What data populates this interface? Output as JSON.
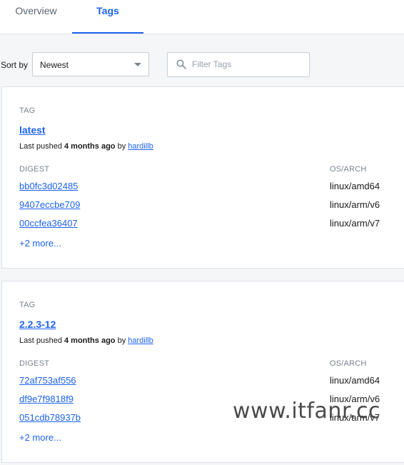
{
  "tabs": [
    {
      "label": "Overview"
    },
    {
      "label": "Tags"
    }
  ],
  "sort": {
    "label": "Sort by",
    "value": "Newest"
  },
  "filter": {
    "placeholder": "Filter Tags"
  },
  "tag_cards": [
    {
      "tag_label": "TAG",
      "tag_name": "latest",
      "pushed_prefix": "Last pushed",
      "pushed_when": "4 months ago",
      "pushed_by": "by",
      "user": "hardillb",
      "digest_header": "DIGEST",
      "os_header": "OS/ARCH",
      "rows": [
        {
          "digest": "bb0fc3d02485",
          "os": "linux/amd64"
        },
        {
          "digest": "9407eccbe709",
          "os": "linux/arm/v6"
        },
        {
          "digest": "00ccfea36407",
          "os": "linux/arm/v7"
        }
      ],
      "more": "+2 more..."
    },
    {
      "tag_label": "TAG",
      "tag_name": "2.2.3-12",
      "pushed_prefix": "Last pushed",
      "pushed_when": "4 months ago",
      "pushed_by": "by",
      "user": "hardillb",
      "digest_header": "DIGEST",
      "os_header": "OS/ARCH",
      "rows": [
        {
          "digest": "72af753af556",
          "os": "linux/amd64"
        },
        {
          "digest": "df9e7f9818f9",
          "os": "linux/arm/v6"
        },
        {
          "digest": "051cdb78937b",
          "os": "linux/arm/v7"
        }
      ],
      "more": "+2 more..."
    }
  ],
  "watermark": "www.itfanr.cc"
}
